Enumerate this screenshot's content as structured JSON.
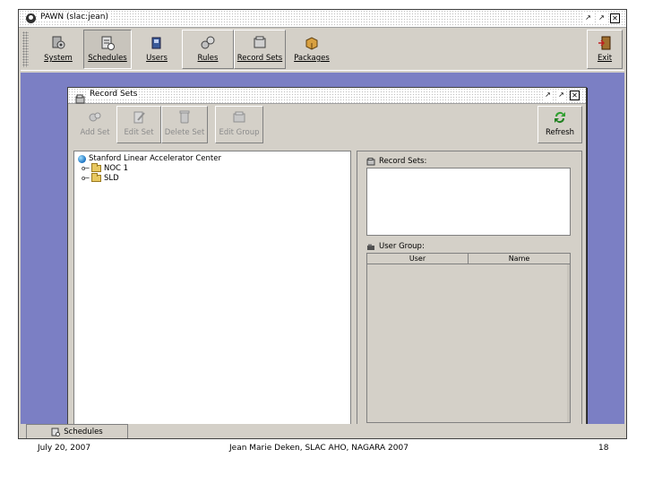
{
  "app": {
    "title": "PAWN (slac:jean)",
    "window_controls": [
      "restore",
      "maximize",
      "close"
    ]
  },
  "toolbar": {
    "items": [
      {
        "label": "System",
        "icon": "system-icon"
      },
      {
        "label": "Schedules",
        "icon": "schedules-icon",
        "state": "pressed"
      },
      {
        "label": "Users",
        "icon": "users-icon"
      },
      {
        "label": "Rules",
        "icon": "rules-icon"
      },
      {
        "label": "Record Sets",
        "icon": "record-sets-icon"
      },
      {
        "label": "Packages",
        "icon": "packages-icon"
      }
    ],
    "exit_label": "Exit"
  },
  "record_sets_window": {
    "title": "Record Sets",
    "buttons": [
      {
        "label": "Add Set",
        "enabled": false
      },
      {
        "label": "Edit Set",
        "enabled": false
      },
      {
        "label": "Delete Set",
        "enabled": false
      },
      {
        "label": "Edit Group",
        "enabled": false
      }
    ],
    "refresh_label": "Refresh",
    "tree": {
      "root": "Stanford Linear Accelerator Center",
      "children": [
        "NOC 1",
        "SLD"
      ]
    },
    "record_sets_label": "Record Sets:",
    "user_group_label": "User Group:",
    "user_group_columns": [
      "User",
      "Name"
    ]
  },
  "tabs": [
    {
      "label": "Schedules",
      "active": true
    }
  ],
  "footer": {
    "date": "July 20, 2007",
    "center": "Jean Marie Deken, SLAC AHO, NAGARA 2007",
    "page": "18"
  },
  "colors": {
    "desktop": "#7b7fc4",
    "panel": "#d4d0c8"
  }
}
